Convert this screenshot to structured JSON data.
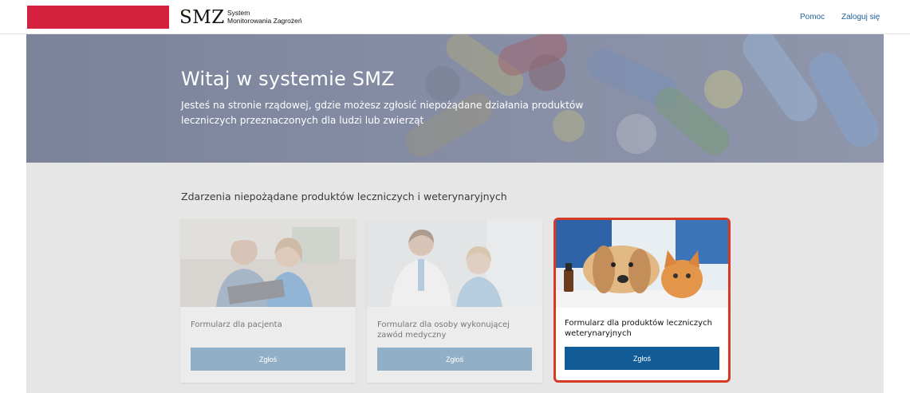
{
  "header": {
    "logo_text": "SMZ",
    "logo_sub_line1": "System",
    "logo_sub_line2": "Monitorowania Zagrożeń",
    "nav": [
      {
        "label": "Pomoc"
      },
      {
        "label": "Zaloguj się"
      }
    ],
    "colors": {
      "flag_red": "#d4213d",
      "link": "#1f5f9a"
    }
  },
  "hero": {
    "title": "Witaj w systemie SMZ",
    "description": "Jesteś na stronie rządowej, gdzie możesz zgłosić niepożądane działania produktów leczniczych przeznaczonych dla ludzi lub zwierząt"
  },
  "main": {
    "section_title": "Zdarzenia niepożądane produktów leczniczych i weterynaryjnych",
    "cards": [
      {
        "title": "Formularz dla pacjenta",
        "button": "Zgłoś",
        "state": "dim"
      },
      {
        "title": "Formularz dla osoby wykonującej zawód medyczny",
        "button": "Zgłoś",
        "state": "dim"
      },
      {
        "title": "Formularz dla produktów leczniczych weterynaryjnych",
        "button": "Zgłoś",
        "state": "active"
      }
    ],
    "colors": {
      "active_border": "#d63a22",
      "active_button": "#115c96",
      "dim_button": "#91b0c8"
    }
  }
}
